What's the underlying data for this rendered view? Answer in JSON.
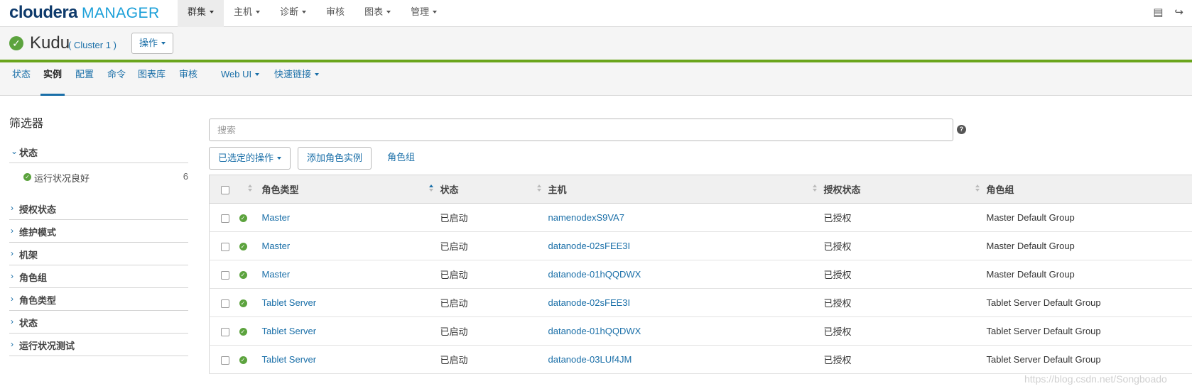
{
  "app": {
    "logo_main": "cloudera",
    "logo_sub": "MANAGER"
  },
  "topnav": [
    {
      "label": "群集",
      "dropdown": true,
      "active": true
    },
    {
      "label": "主机",
      "dropdown": true
    },
    {
      "label": "诊断",
      "dropdown": true
    },
    {
      "label": "审核",
      "dropdown": false
    },
    {
      "label": "图表",
      "dropdown": true
    },
    {
      "label": "管理",
      "dropdown": true
    }
  ],
  "top_icons": [
    "support-icon",
    "logout-icon"
  ],
  "service": {
    "name": "Kudu",
    "cluster": "( Cluster 1 )",
    "status_icon": "health-good-icon",
    "actions_label": "操作"
  },
  "subtabs": [
    {
      "label": "状态"
    },
    {
      "label": "实例",
      "active": true
    },
    {
      "label": "配置"
    },
    {
      "label": "命令"
    },
    {
      "label": "图表库"
    },
    {
      "label": "审核"
    },
    {
      "label": "Web UI",
      "dropdown": true
    },
    {
      "label": "快速链接",
      "dropdown": true
    }
  ],
  "sidebar": {
    "title": "筛选器",
    "status_section": {
      "label": "状态",
      "expanded": true,
      "items": [
        {
          "label": "运行状况良好",
          "count": "6"
        }
      ]
    },
    "sections": [
      "授权状态",
      "维护模式",
      "机架",
      "角色组",
      "角色类型",
      "状态",
      "运行状况测试"
    ]
  },
  "main": {
    "search_placeholder": "搜索",
    "help_icon": "question-icon",
    "selected_actions_label": "已选定的操作",
    "add_role_label": "添加角色实例",
    "role_groups_link": "角色组",
    "table": {
      "headers": [
        "角色类型",
        "状态",
        "主机",
        "授权状态",
        "角色组"
      ],
      "rows": [
        [
          "Master",
          "已启动",
          "namenodexS9VA7",
          "已授权",
          "Master Default Group"
        ],
        [
          "Master",
          "已启动",
          "datanode-02sFEE3I",
          "已授权",
          "Master Default Group"
        ],
        [
          "Master",
          "已启动",
          "datanode-01hQQDWX",
          "已授权",
          "Master Default Group"
        ],
        [
          "Tablet Server",
          "已启动",
          "datanode-02sFEE3I",
          "已授权",
          "Tablet Server Default Group"
        ],
        [
          "Tablet Server",
          "已启动",
          "datanode-01hQQDWX",
          "已授权",
          "Tablet Server Default Group"
        ],
        [
          "Tablet Server",
          "已启动",
          "datanode-03LUf4JM",
          "已授权",
          "Tablet Server Default Group"
        ]
      ]
    }
  },
  "watermark": "https://blog.csdn.net/Songboado",
  "colors": {
    "accent": "#1a6fa8",
    "health_good": "#5ca33e",
    "service_bar": "#6aa51c"
  }
}
